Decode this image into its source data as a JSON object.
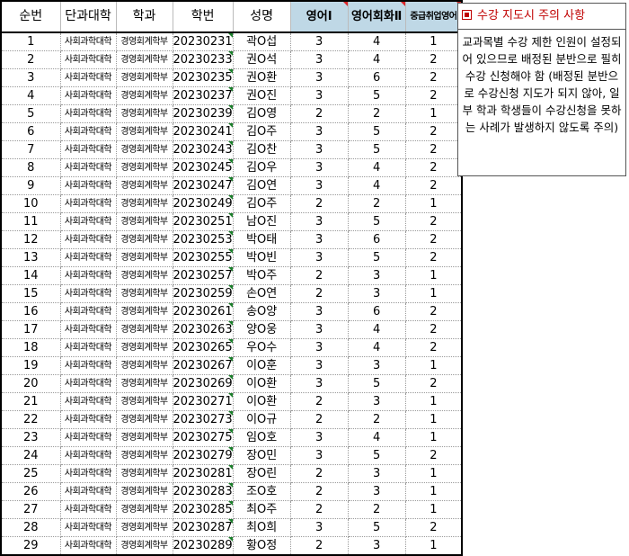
{
  "headers": [
    "순번",
    "단과대학",
    "학과",
    "학번",
    "성명",
    "영어Ⅰ",
    "영어회화Ⅱ",
    "중급취업영어"
  ],
  "rows": [
    [
      "1",
      "사회과학대학",
      "경영회계학부",
      "20230231",
      "곽O섭",
      "3",
      "4",
      "1"
    ],
    [
      "2",
      "사회과학대학",
      "경영회계학부",
      "20230233",
      "권O석",
      "3",
      "4",
      "2"
    ],
    [
      "3",
      "사회과학대학",
      "경영회계학부",
      "20230235",
      "권O환",
      "3",
      "6",
      "2"
    ],
    [
      "4",
      "사회과학대학",
      "경영회계학부",
      "20230237",
      "권O진",
      "3",
      "5",
      "2"
    ],
    [
      "5",
      "사회과학대학",
      "경영회계학부",
      "20230239",
      "김O영",
      "2",
      "2",
      "1"
    ],
    [
      "6",
      "사회과학대학",
      "경영회계학부",
      "20230241",
      "김O주",
      "3",
      "5",
      "2"
    ],
    [
      "7",
      "사회과학대학",
      "경영회계학부",
      "20230243",
      "김O찬",
      "3",
      "5",
      "2"
    ],
    [
      "8",
      "사회과학대학",
      "경영회계학부",
      "20230245",
      "김O우",
      "3",
      "4",
      "2"
    ],
    [
      "9",
      "사회과학대학",
      "경영회계학부",
      "20230247",
      "김O연",
      "3",
      "4",
      "2"
    ],
    [
      "10",
      "사회과학대학",
      "경영회계학부",
      "20230249",
      "김O주",
      "2",
      "2",
      "1"
    ],
    [
      "11",
      "사회과학대학",
      "경영회계학부",
      "20230251",
      "남O진",
      "3",
      "5",
      "2"
    ],
    [
      "12",
      "사회과학대학",
      "경영회계학부",
      "20230253",
      "박O태",
      "3",
      "6",
      "2"
    ],
    [
      "13",
      "사회과학대학",
      "경영회계학부",
      "20230255",
      "박O빈",
      "3",
      "5",
      "2"
    ],
    [
      "14",
      "사회과학대학",
      "경영회계학부",
      "20230257",
      "박O주",
      "2",
      "3",
      "1"
    ],
    [
      "15",
      "사회과학대학",
      "경영회계학부",
      "20230259",
      "손O연",
      "2",
      "3",
      "1"
    ],
    [
      "16",
      "사회과학대학",
      "경영회계학부",
      "20230261",
      "송O양",
      "3",
      "6",
      "2"
    ],
    [
      "17",
      "사회과학대학",
      "경영회계학부",
      "20230263",
      "양O웅",
      "3",
      "4",
      "2"
    ],
    [
      "18",
      "사회과학대학",
      "경영회계학부",
      "20230265",
      "우O수",
      "3",
      "4",
      "2"
    ],
    [
      "19",
      "사회과학대학",
      "경영회계학부",
      "20230267",
      "이O훈",
      "3",
      "3",
      "1"
    ],
    [
      "20",
      "사회과학대학",
      "경영회계학부",
      "20230269",
      "이O환",
      "3",
      "5",
      "2"
    ],
    [
      "21",
      "사회과학대학",
      "경영회계학부",
      "20230271",
      "이O환",
      "2",
      "3",
      "1"
    ],
    [
      "22",
      "사회과학대학",
      "경영회계학부",
      "20230273",
      "이O규",
      "2",
      "2",
      "1"
    ],
    [
      "23",
      "사회과학대학",
      "경영회계학부",
      "20230275",
      "임O호",
      "3",
      "4",
      "1"
    ],
    [
      "24",
      "사회과학대학",
      "경영회계학부",
      "20230279",
      "장O민",
      "3",
      "5",
      "2"
    ],
    [
      "25",
      "사회과학대학",
      "경영회계학부",
      "20230281",
      "장O린",
      "2",
      "3",
      "1"
    ],
    [
      "26",
      "사회과학대학",
      "경영회계학부",
      "20230283",
      "조O호",
      "2",
      "3",
      "1"
    ],
    [
      "27",
      "사회과학대학",
      "경영회계학부",
      "20230285",
      "최O주",
      "2",
      "2",
      "1"
    ],
    [
      "28",
      "사회과학대학",
      "경영회계학부",
      "20230287",
      "최O희",
      "3",
      "5",
      "2"
    ],
    [
      "29",
      "사회과학대학",
      "경영회계학부",
      "20230289",
      "황O정",
      "2",
      "3",
      "1"
    ]
  ],
  "note": {
    "title": "수강 지도시 주의 사항",
    "body": "교과목별 수강 제한 인원이 설정되어 있으므로 배정된 분반으로 필히 수강 신청해야 함 (배정된 분반으로 수강신청 지도가 되지 않아, 일부 학과 학생들이 수강신청을 못하는 사례가 발생하지 않도록 주의)"
  },
  "colors": {
    "english_header_bg": "#bfd8e6",
    "note_title": "#c00000",
    "comment_marker": "#d8262a",
    "text_number_marker": "#1a7f2a"
  }
}
